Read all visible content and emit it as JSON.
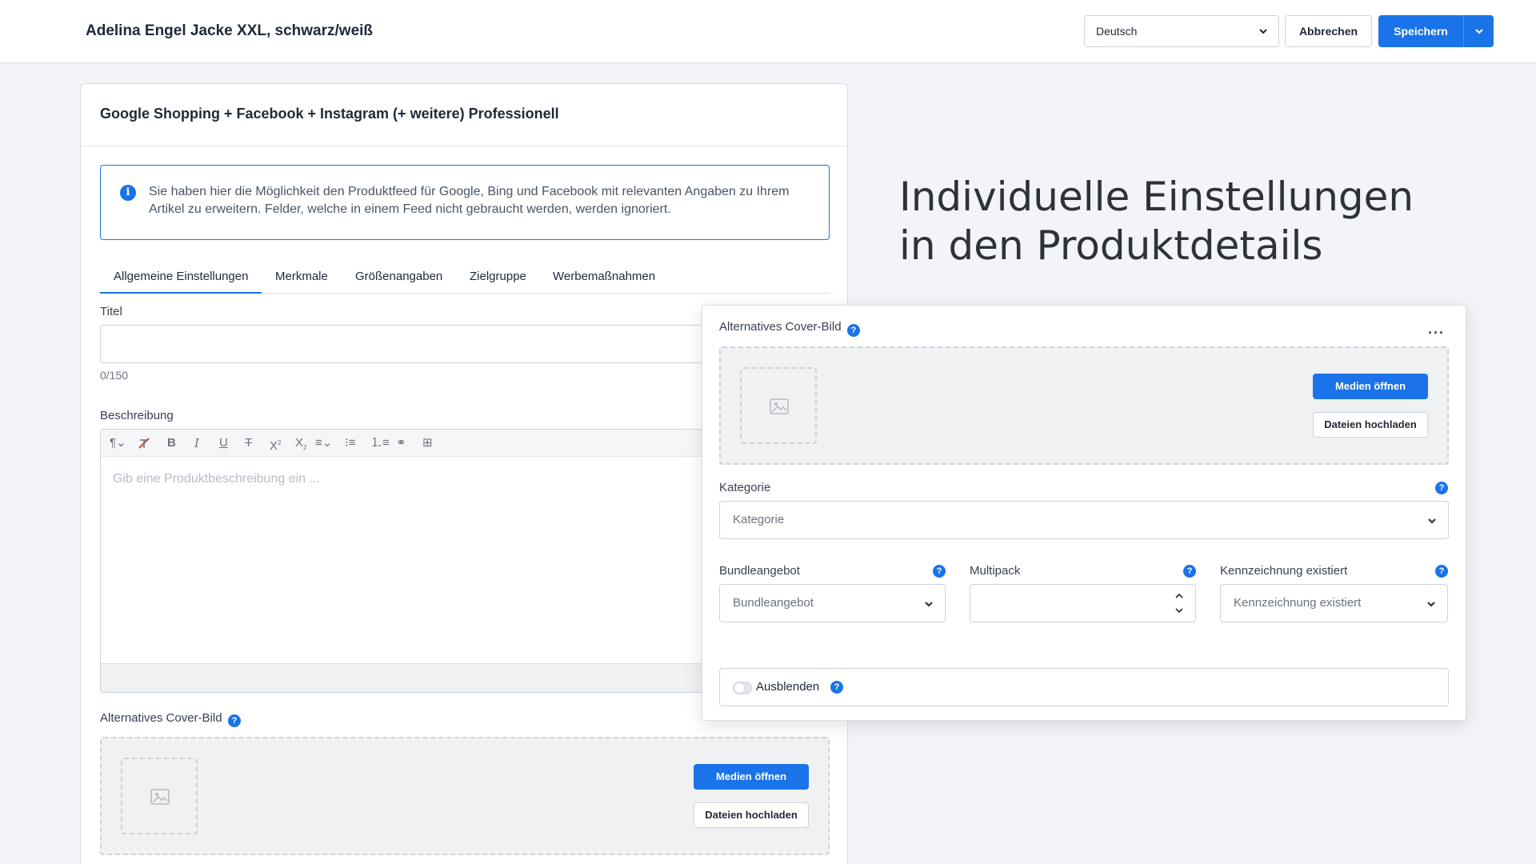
{
  "header": {
    "product_title": "Adelina Engel Jacke XXL, schwarz/weiß",
    "language": "Deutsch",
    "cancel_label": "Abbrechen",
    "save_label": "Speichern"
  },
  "card": {
    "title": "Google Shopping + Facebook + Instagram (+ weitere) Professionell",
    "info_text": "Sie haben hier die Möglichkeit den Produktfeed für Google, Bing und Facebook mit relevanten Angaben zu Ihrem Artikel zu erweitern. Felder, welche in einem Feed nicht gebraucht werden, werden ignoriert.",
    "tabs": [
      {
        "label": "Allgemeine Einstellungen",
        "active": true
      },
      {
        "label": "Merkmale"
      },
      {
        "label": "Größenangaben"
      },
      {
        "label": "Zielgruppe"
      },
      {
        "label": "Werbemaßnahmen"
      }
    ],
    "titel_label": "Titel",
    "titel_value": "",
    "titel_counter": "0/150",
    "beschreibung_label": "Beschreibung",
    "beschreibung_placeholder": "Gib eine Produktbeschreibung ein ...",
    "cover_label": "Alternatives Cover-Bild",
    "media_open": "Medien öffnen",
    "upload_files": "Dateien hochladen"
  },
  "headline": {
    "line1": "Individuelle Einstellungen",
    "line2": "in den Produktdetails"
  },
  "overlay": {
    "cover_label": "Alternatives Cover-Bild",
    "media_open": "Medien öffnen",
    "upload_files": "Dateien hochladen",
    "kategorie_label": "Kategorie",
    "kategorie_placeholder": "Kategorie",
    "bundle_label": "Bundleangebot",
    "bundle_placeholder": "Bundleangebot",
    "multipack_label": "Multipack",
    "multipack_value": "",
    "kennzeichnung_label": "Kennzeichnung existiert",
    "kennzeichnung_placeholder": "Kennzeichnung existiert",
    "ausblenden_label": "Ausblenden",
    "ausblenden_on": false
  },
  "help_glyph": "?",
  "info_glyph": "i",
  "more_glyph": "···",
  "colors": {
    "accent": "#1a73e8"
  }
}
